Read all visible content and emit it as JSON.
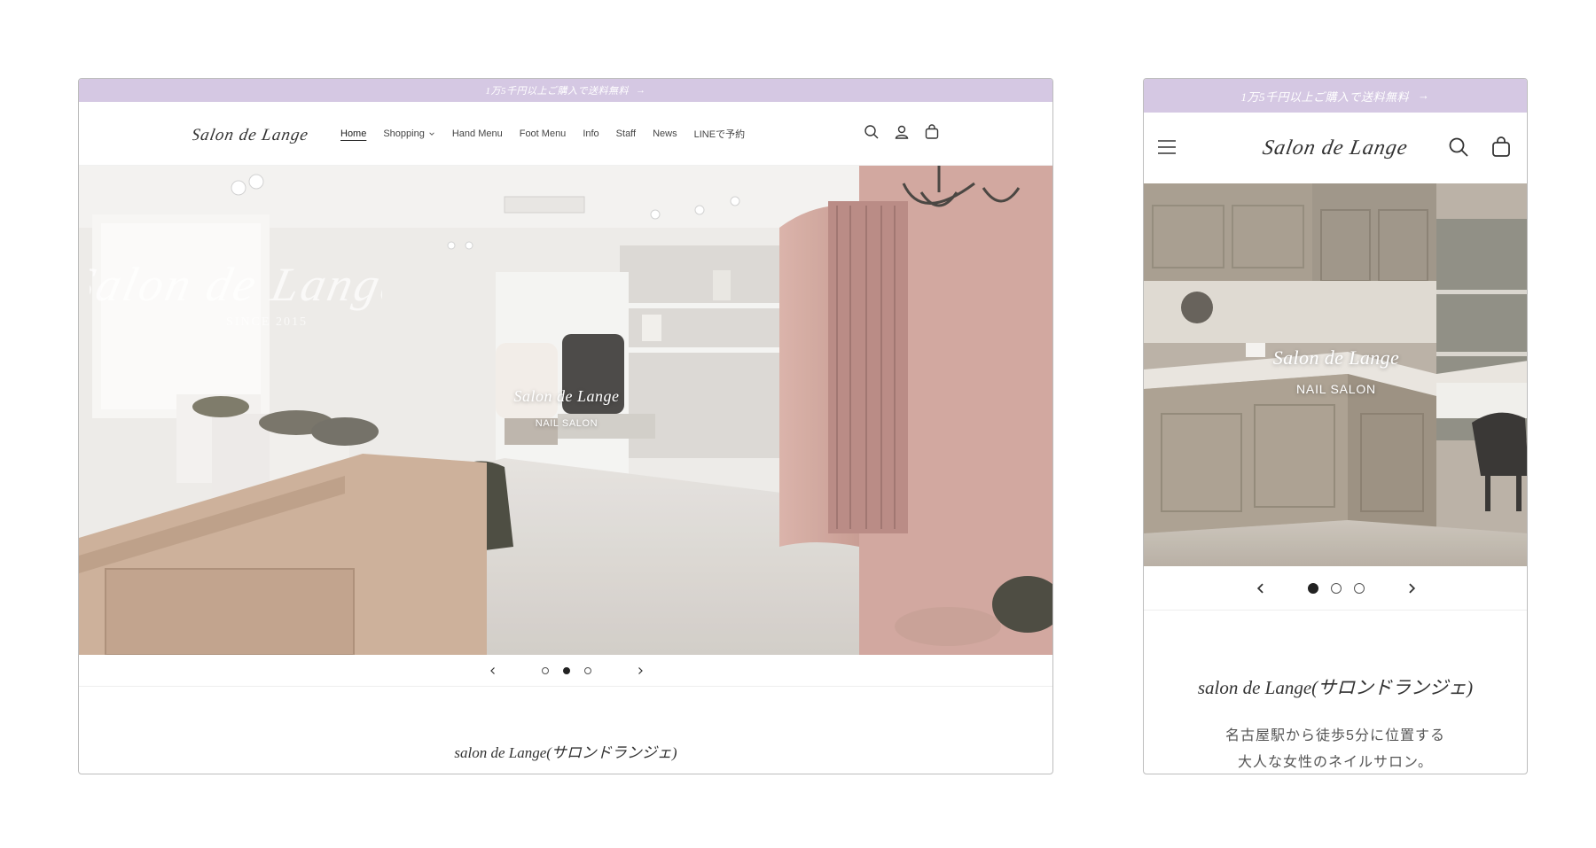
{
  "announcement": {
    "text": "1万5千円以上ご購入で送料無料",
    "arrow": "→"
  },
  "brand": {
    "logo_text": "Salon de Lange",
    "hero_script_text": "Salon de Lange",
    "hero_script_since": "SINCE 2015",
    "accent": "#d5c8e3"
  },
  "desktop": {
    "nav": [
      {
        "label": "Home",
        "active": true
      },
      {
        "label": "Shopping",
        "dropdown": true
      },
      {
        "label": "Hand Menu"
      },
      {
        "label": "Foot Menu"
      },
      {
        "label": "Info"
      },
      {
        "label": "Staff"
      },
      {
        "label": "News"
      },
      {
        "label": "LINEで予約"
      }
    ],
    "header_icons": [
      "search-icon",
      "account-icon",
      "cart-icon"
    ],
    "hero": {
      "title": "Salon de Lange",
      "subtitle": "NAIL SALON"
    },
    "slider": {
      "active_index": 1,
      "count": 3
    },
    "intro_title": "salon de Lange(サロンドランジェ)"
  },
  "mobile": {
    "header_icons": [
      "menu-icon",
      "search-icon",
      "cart-icon"
    ],
    "hero": {
      "title": "Salon de Lange",
      "subtitle": "NAIL SALON"
    },
    "slider": {
      "active_index": 0,
      "count": 3
    },
    "intro_title": "salon de Lange(サロンドランジェ)",
    "description": [
      "名古屋駅から徒歩5分に位置する",
      "大人な女性のネイルサロン。"
    ]
  }
}
